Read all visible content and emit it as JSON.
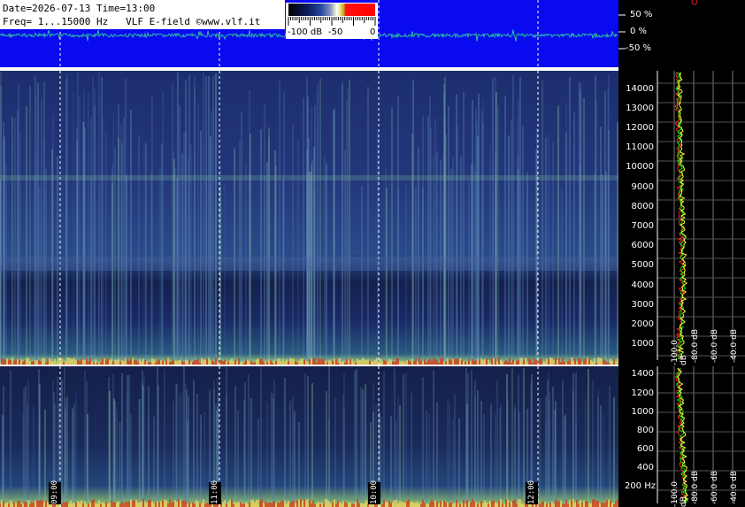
{
  "header": {
    "line1": "Date=2026-07-13 Time=13:00",
    "line2": "Freq= 1...15000 Hz   VLF E-field ©www.vlf.it"
  },
  "colorbar": {
    "labels": [
      "-100 dB",
      "-50",
      "0"
    ]
  },
  "waveform_scale": {
    "labels": [
      "50 %",
      "0 %",
      "-50 %"
    ]
  },
  "hours": [
    "09:00",
    "11:00",
    "10:00",
    "12:00"
  ],
  "top_axis": {
    "freq_labels": [
      "14000",
      "13000",
      "12000",
      "11000",
      "10000",
      "9000",
      "8000",
      "7000",
      "6000",
      "5000",
      "4000",
      "3000",
      "2000",
      "1000"
    ],
    "db_labels": [
      "-100.0 dB",
      "-80.0 dB",
      "-60.0 dB",
      "-40.0 dB",
      "-20.0 dB"
    ]
  },
  "bottom_axis": {
    "freq_labels": [
      "1400",
      "1200",
      "1000",
      "800",
      "600",
      "400",
      "200 Hz"
    ],
    "db_labels": [
      "-100.0 dB",
      "-80.0 dB",
      "-60.0 dB",
      "-40.0 dB",
      "-20.0 dB"
    ]
  },
  "colors": {
    "waveform_bg": "#0a0af0",
    "trace_green": "#00e000",
    "trace_yellow": "#ffff40",
    "trace_red": "#ff2020"
  }
}
